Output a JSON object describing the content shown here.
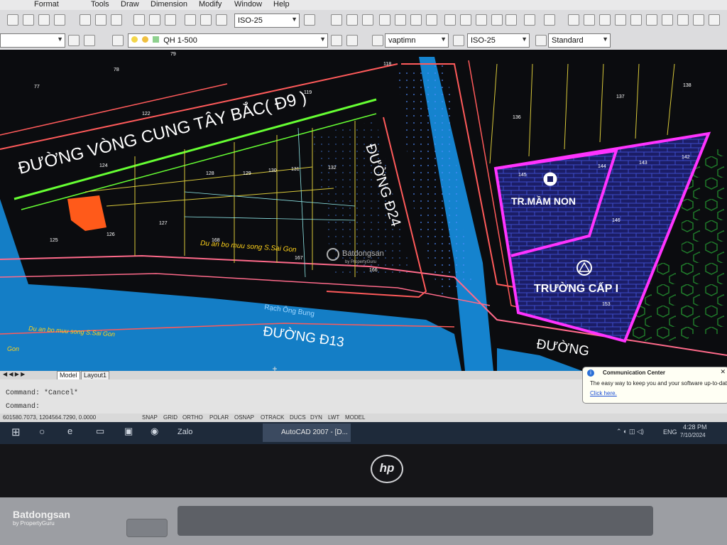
{
  "window": {
    "app_button_label": "AutoCAD 2007 - [D..."
  },
  "menu": {
    "items": [
      "Format",
      "Tools",
      "Draw",
      "Dimension",
      "Modify",
      "Window",
      "Help"
    ]
  },
  "toolbar": {
    "dim_style": "ISO-25",
    "layer": "QH 1-500",
    "text_style": "vaptimn",
    "dim_style2": "ISO-25",
    "table_style": "Standard"
  },
  "drawing": {
    "roads": [
      "ĐƯỜNG VÒNG CUNG TÂY BẮC( Đ9 )",
      "ĐƯỜNG Đ24",
      "ĐƯỜNG Đ13",
      "ĐƯỜNG"
    ],
    "schools": [
      "TR.MẦM NON",
      "TRƯỜNG CẤP I"
    ],
    "project_label": "Du an bo muu song S.Sai Gon",
    "canal_label": "Rạch Ông Bung",
    "bottom_labels": [
      "Du an bo muu song S.Sai Gon",
      "Gon"
    ],
    "lot_numbers": [
      "78",
      "77",
      "79",
      "118",
      "119",
      "122",
      "124",
      "125",
      "126",
      "127",
      "128",
      "129",
      "130",
      "131",
      "132",
      "136",
      "137",
      "138",
      "142",
      "143",
      "144",
      "145",
      "146",
      "153",
      "166",
      "167",
      "168"
    ],
    "watermark": "Batdongsan",
    "watermark_sub": "by PropertyGuru"
  },
  "layout_tabs": [
    "Model",
    "Layout1"
  ],
  "command": {
    "line1": "Command: *Cancel*",
    "line2": "Command:"
  },
  "status": {
    "coords": "601580.7073, 1204564.7290, 0.0000",
    "toggles": [
      "SNAP",
      "GRID",
      "ORTHO",
      "POLAR",
      "OSNAP",
      "OTRACK",
      "DUCS",
      "DYN",
      "LWT",
      "MODEL"
    ]
  },
  "notification": {
    "title": "Communication Center",
    "body": "The easy way to keep you and your software up-to-date.",
    "link": "Click here."
  },
  "taskbar": {
    "zalo": "Zalo",
    "lang": "ENG",
    "time": "4:28 PM",
    "date": "7/10/2024"
  },
  "laptop": {
    "brand": "hp"
  },
  "photo_watermark": {
    "name": "Batdongsan",
    "sub": "by PropertyGuru"
  },
  "colors": {
    "canal": "#1aa8ff",
    "school_boundary": "#ff33ff",
    "road_green": "#66ff33",
    "road_red": "#ff5a5a"
  }
}
